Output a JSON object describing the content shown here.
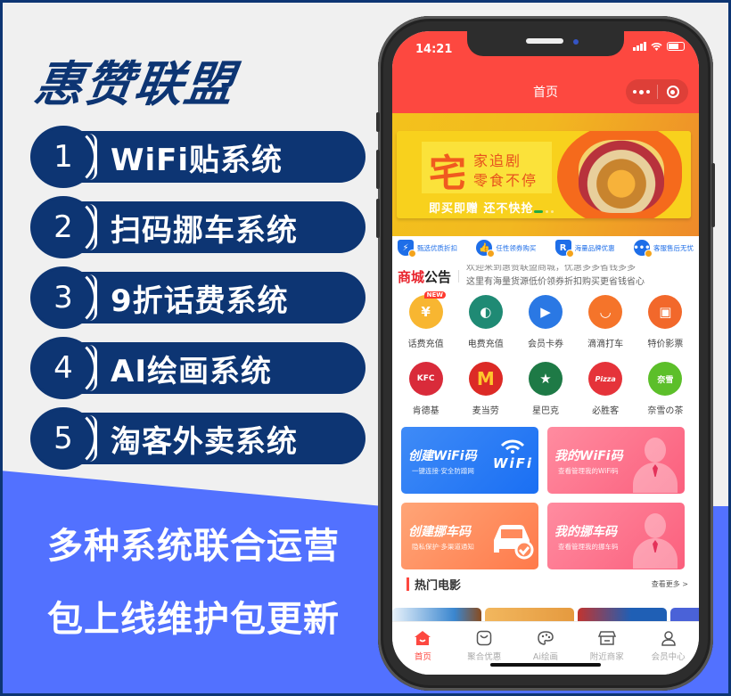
{
  "poster": {
    "brand_title": "惠赞联盟",
    "features": [
      {
        "number": "1",
        "label": "WiFi贴系统"
      },
      {
        "number": "2",
        "label": "扫码挪车系统"
      },
      {
        "number": "3",
        "label": "9折话费系统"
      },
      {
        "number": "4",
        "label": "AI绘画系统"
      },
      {
        "number": "5",
        "label": "淘客外卖系统"
      }
    ],
    "tagline_1": "多种系统联合运营",
    "tagline_2": "包上线维护包更新",
    "colors": {
      "navy": "#0d3573",
      "promo_blue": "#5271ff",
      "app_red": "#fd4840"
    }
  },
  "phone": {
    "status_bar": {
      "time": "14:21"
    },
    "nav": {
      "title": "首页",
      "more_icon": "more-dots-icon",
      "close_icon": "target-icon"
    },
    "banner": {
      "big_char": "宅",
      "line1": "家追剧",
      "line2": "零食不停",
      "cta": "即买即赠 还不快抢",
      "slide_index": 1,
      "slide_count": 3
    },
    "guarantees": [
      {
        "icon": "lightning-shield-icon",
        "glyph": "⚡",
        "label": "甄选优质折扣"
      },
      {
        "icon": "thumbs-up-icon",
        "glyph": "👍",
        "label": "任性领券购买"
      },
      {
        "icon": "brand-r-icon",
        "glyph": "R",
        "label": "海量品牌优惠"
      },
      {
        "icon": "chat-dots-icon",
        "glyph": "•••",
        "label": "客服售后无忧"
      }
    ],
    "notice": {
      "tag_red": "商城",
      "tag_black": "公告",
      "previous_text": "欢迎来到惠赞联盟商城，优惠多多省钱多多",
      "current_text": "这里有海量货源低价领券折扣购买更省钱省心"
    },
    "service_grid_row1": [
      {
        "icon": "phone-recharge-icon",
        "label": "话费充值",
        "badge": "NEW",
        "color": "#f8b631",
        "glyph": "¥"
      },
      {
        "icon": "electricity-icon",
        "label": "电费充值",
        "color": "#1f8a74",
        "glyph": "◐"
      },
      {
        "icon": "video-play-icon",
        "label": "会员卡券",
        "color": "#2a78e4",
        "glyph": "▶"
      },
      {
        "icon": "didi-icon",
        "label": "滴滴打车",
        "color": "#f5742a",
        "glyph": "◡"
      },
      {
        "icon": "movie-ticket-icon",
        "label": "特价影票",
        "color": "#f2682b",
        "glyph": "▣"
      }
    ],
    "service_grid_row2": [
      {
        "icon": "kfc-icon",
        "label": "肯德基",
        "color": "#d92b3a",
        "glyph": "KFC"
      },
      {
        "icon": "mcdonalds-icon",
        "label": "麦当劳",
        "color": "#dc2a26",
        "glyph": "M"
      },
      {
        "icon": "starbucks-icon",
        "label": "星巴克",
        "color": "#1e7a46",
        "glyph": "★"
      },
      {
        "icon": "pizza-hut-icon",
        "label": "必胜客",
        "color": "#e5333a",
        "glyph": "Pizza"
      },
      {
        "icon": "nayuki-icon",
        "label": "奈雪の茶",
        "color": "#5cbf2a",
        "glyph": "奈雪"
      }
    ],
    "cards": [
      {
        "title": "创建WiFi码",
        "subtitle": "一键连接·安全防蹭网",
        "icon": "wifi-icon",
        "illustration_text": "WiFi"
      },
      {
        "title": "我的WiFi码",
        "subtitle": "查看管理我的WiFi码",
        "icon": "person-icon"
      },
      {
        "title": "创建挪车码",
        "subtitle": "隐私保护·多渠道通知",
        "icon": "car-check-icon"
      },
      {
        "title": "我的挪车码",
        "subtitle": "查看管理我的挪车码",
        "icon": "person-icon"
      }
    ],
    "hot_movies": {
      "title": "热门电影",
      "more": "查看更多 >"
    },
    "tabbar": [
      {
        "icon": "home-icon",
        "label": "首页",
        "active": true
      },
      {
        "icon": "shopping-bag-icon",
        "label": "聚合优惠",
        "active": false
      },
      {
        "icon": "palette-icon",
        "label": "Ai绘画",
        "active": false
      },
      {
        "icon": "store-icon",
        "label": "附近商家",
        "active": false
      },
      {
        "icon": "user-icon",
        "label": "会员中心",
        "active": false
      }
    ]
  }
}
